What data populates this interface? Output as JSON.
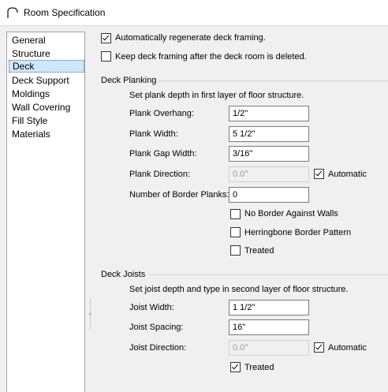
{
  "window": {
    "title": "Room Specification"
  },
  "nav": {
    "items": [
      "General",
      "Structure",
      "Deck",
      "Deck Support",
      "Moldings",
      "Wall Covering",
      "Fill Style",
      "Materials"
    ],
    "selected": "Deck"
  },
  "options": {
    "auto_regen": {
      "label": "Automatically regenerate deck framing.",
      "checked": true
    },
    "keep_framing": {
      "label": "Keep deck framing after the deck room is deleted.",
      "checked": false
    }
  },
  "planking": {
    "section_title": "Deck Planking",
    "hint": "Set plank depth in first layer of floor structure.",
    "overhang": {
      "label": "Plank Overhang:",
      "value": "1/2\""
    },
    "width": {
      "label": "Plank Width:",
      "value": "5 1/2\""
    },
    "gap": {
      "label": "Plank Gap Width:",
      "value": "3/16\""
    },
    "direction": {
      "label": "Plank Direction:",
      "value": "0.0°",
      "auto_label": "Automatic",
      "auto_checked": true
    },
    "border_planks": {
      "label": "Number of Border Planks:",
      "value": "0"
    },
    "no_border": {
      "label": "No Border Against Walls",
      "checked": false
    },
    "herringbone": {
      "label": "Herringbone Border Pattern",
      "checked": false
    },
    "treated": {
      "label": "Treated",
      "checked": false
    }
  },
  "joists": {
    "section_title": "Deck Joists",
    "hint": "Set joist depth and type in second layer of floor structure.",
    "width": {
      "label": "Joist Width:",
      "value": "1 1/2\""
    },
    "spacing": {
      "label": "Joist Spacing:",
      "value": "16\""
    },
    "direction": {
      "label": "Joist Direction:",
      "value": "0.0°",
      "auto_label": "Automatic",
      "auto_checked": true
    },
    "treated": {
      "label": "Treated",
      "checked": true
    }
  }
}
